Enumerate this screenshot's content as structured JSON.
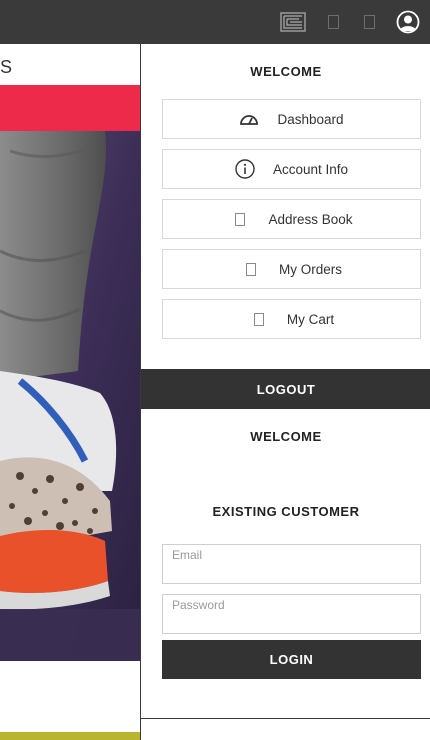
{
  "topbar": {
    "icons": [
      "brand-logo-icon",
      "square-icon",
      "square-icon",
      "user-account-icon"
    ],
    "background": "#3a3a3a"
  },
  "background_page": {
    "partial_text": "S",
    "accent_color": "#ee2a4a"
  },
  "account_menu": {
    "heading": "WELCOME",
    "items": [
      {
        "label": "Dashboard",
        "icon": "dashboard-gauge-icon"
      },
      {
        "label": "Account Info",
        "icon": "info-icon"
      },
      {
        "label": "Address Book",
        "icon": "address-book-icon"
      },
      {
        "label": "My Orders",
        "icon": "orders-icon"
      },
      {
        "label": "My Cart",
        "icon": "cart-icon"
      }
    ],
    "logout_label": "LOGOUT"
  },
  "login": {
    "welcome": "WELCOME",
    "section_title": "EXISTING CUSTOMER",
    "email_placeholder": "Email",
    "password_placeholder": "Password",
    "login_label": "LOGIN"
  }
}
